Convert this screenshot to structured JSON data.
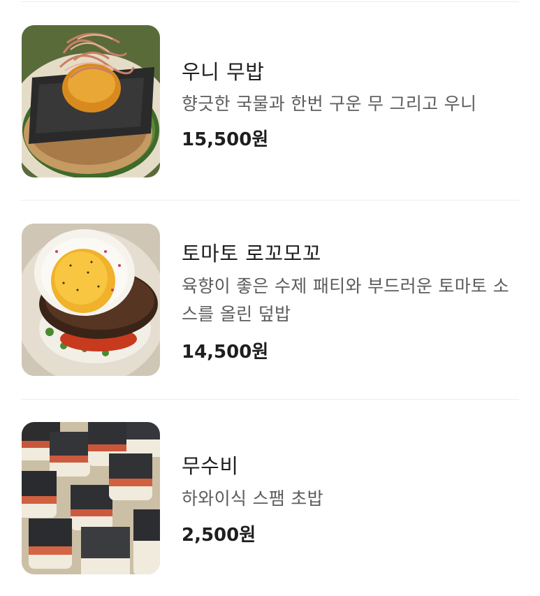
{
  "menu": {
    "items": [
      {
        "name": "우니 무밥",
        "description": "향긋한 국물과 한번 구운 무 그리고 우니",
        "price": "15,500원",
        "image_icon": "bowl-with-seaweed-and-bonito-photo"
      },
      {
        "name": "토마토 로꼬모꼬",
        "description": "육향이 좋은 수제 패티와 부드러운 토마토 소스를 올린 덮밥",
        "price": "14,500원",
        "image_icon": "fried-egg-patty-rice-bowl-photo"
      },
      {
        "name": "무수비",
        "description": "하와이식 스팸 초밥",
        "price": "2,500원",
        "image_icon": "spam-musubi-tray-photo"
      }
    ]
  }
}
